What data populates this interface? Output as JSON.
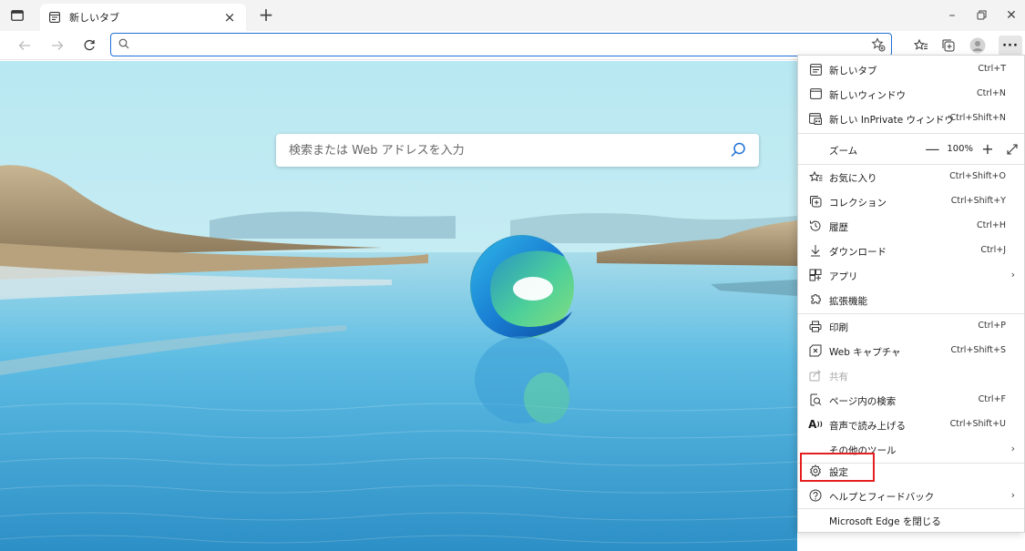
{
  "tab": {
    "title": "新しいタブ"
  },
  "address_bar": {
    "value": ""
  },
  "search": {
    "placeholder": "検索または Web アドレスを入力"
  },
  "menu": {
    "new_tab": {
      "label": "新しいタブ",
      "shortcut": "Ctrl+T"
    },
    "new_window": {
      "label": "新しいウィンドウ",
      "shortcut": "Ctrl+N"
    },
    "new_inprivate": {
      "label": "新しい InPrivate ウィンドウ",
      "shortcut": "Ctrl+Shift+N"
    },
    "zoom": {
      "label": "ズーム",
      "value": "100%",
      "minus": "—",
      "plus": "+"
    },
    "favorites": {
      "label": "お気に入り",
      "shortcut": "Ctrl+Shift+O"
    },
    "collections": {
      "label": "コレクション",
      "shortcut": "Ctrl+Shift+Y"
    },
    "history": {
      "label": "履歴",
      "shortcut": "Ctrl+H"
    },
    "downloads": {
      "label": "ダウンロード",
      "shortcut": "Ctrl+J"
    },
    "apps": {
      "label": "アプリ"
    },
    "extensions": {
      "label": "拡張機能"
    },
    "print": {
      "label": "印刷",
      "shortcut": "Ctrl+P"
    },
    "web_capture": {
      "label": "Web キャプチャ",
      "shortcut": "Ctrl+Shift+S"
    },
    "share": {
      "label": "共有"
    },
    "find": {
      "label": "ページ内の検索",
      "shortcut": "Ctrl+F"
    },
    "read_aloud": {
      "label": "音声で読み上げる",
      "shortcut": "Ctrl+Shift+U"
    },
    "more_tools": {
      "label": "その他のツール"
    },
    "settings": {
      "label": "設定"
    },
    "help": {
      "label": "ヘルプとフィードバック"
    },
    "close_edge": {
      "label": "Microsoft Edge を閉じる"
    }
  },
  "colors": {
    "accent": "#1f6fd6",
    "highlight": "#e41f1f",
    "sky": "#bfe9f2",
    "water": "#3aa6d8"
  }
}
